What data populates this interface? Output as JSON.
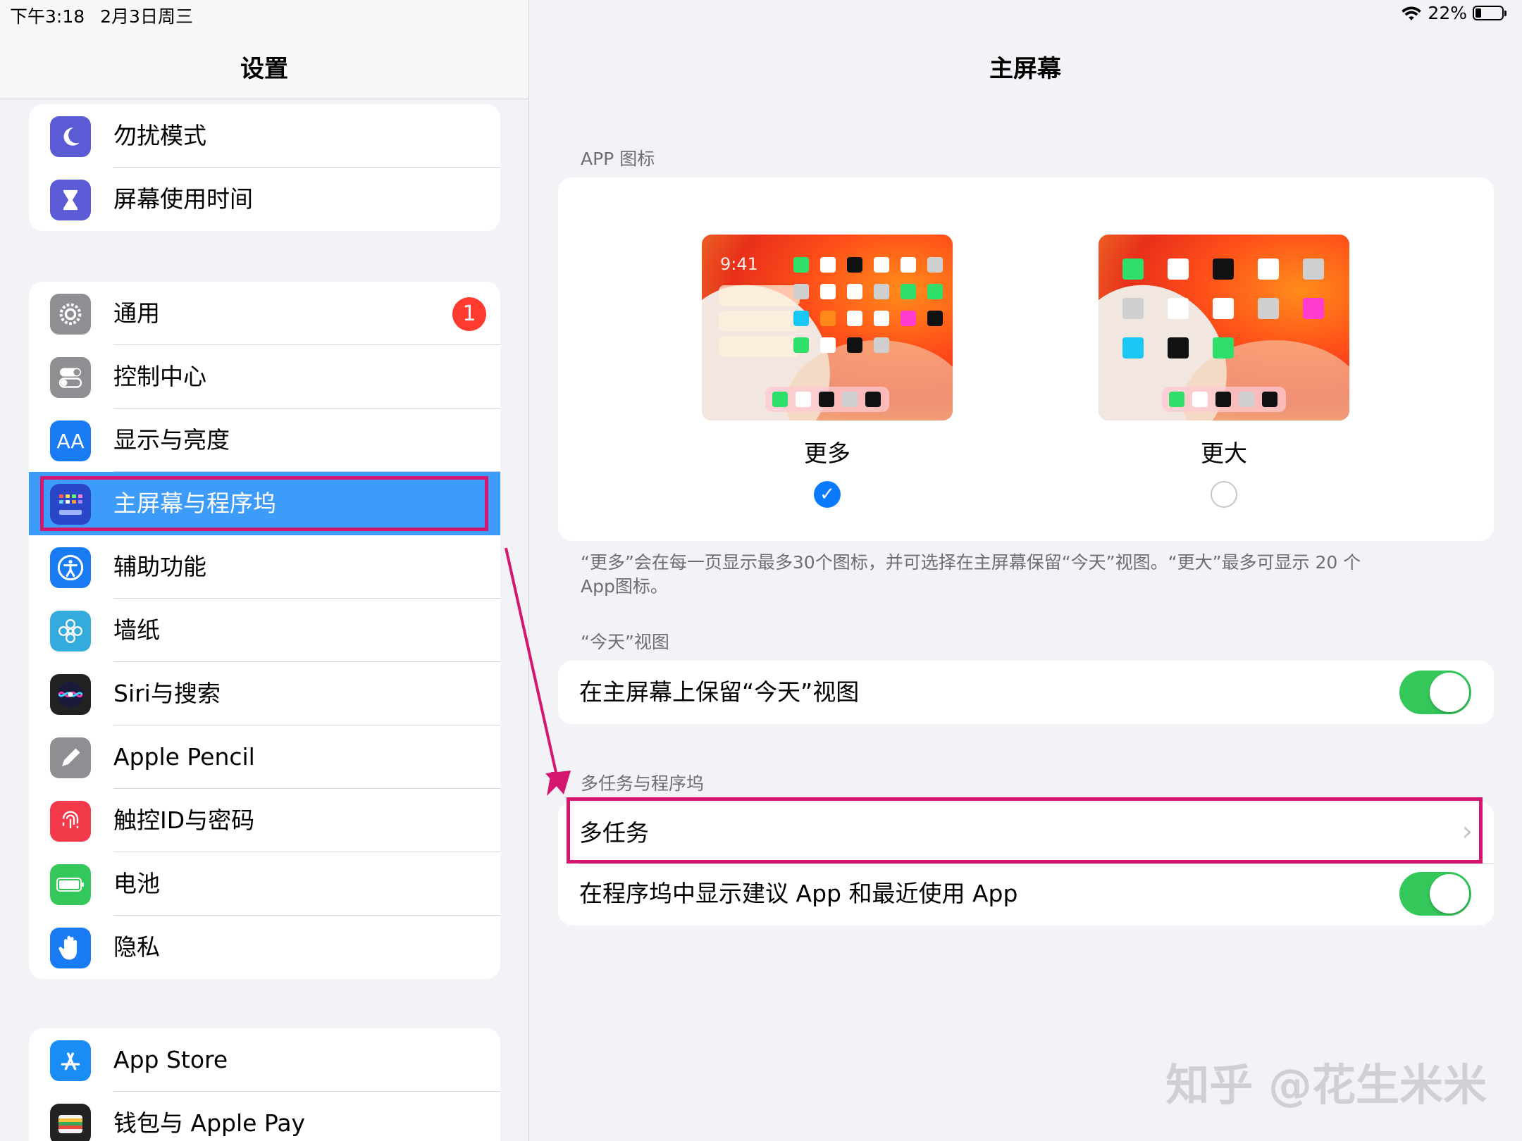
{
  "status_bar": {
    "time": "下午3:18",
    "date": "2月3日周三",
    "battery_percent": "22%",
    "battery_level": 0.22
  },
  "sidebar": {
    "title": "设置",
    "group1": [
      {
        "label": "勿扰模式",
        "icon": "moon-icon",
        "color": "#5b5bd6"
      },
      {
        "label": "屏幕使用时间",
        "icon": "hourglass-icon",
        "color": "#5b5bd6"
      }
    ],
    "group2": [
      {
        "label": "通用",
        "icon": "gear-icon",
        "color": "#8e8e93",
        "badge": "1"
      },
      {
        "label": "控制中心",
        "icon": "toggles-icon",
        "color": "#8e8e93"
      },
      {
        "label": "显示与亮度",
        "icon": "text-size-icon",
        "color": "#1a7cf5",
        "icon_text": "AA"
      },
      {
        "label": "主屏幕与程序坞",
        "icon": "home-grid-icon",
        "color": "#2a46c8",
        "selected": true
      },
      {
        "label": "辅助功能",
        "icon": "accessibility-icon",
        "color": "#1a7cf5"
      },
      {
        "label": "墙纸",
        "icon": "flower-icon",
        "color": "#35aadc"
      },
      {
        "label": "Siri与搜索",
        "icon": "siri-icon",
        "color": "#222"
      },
      {
        "label": "Apple Pencil",
        "icon": "pencil-icon",
        "color": "#8e8e93"
      },
      {
        "label": "触控ID与密码",
        "icon": "fingerprint-icon",
        "color": "#f23a4a"
      },
      {
        "label": "电池",
        "icon": "battery-icon",
        "color": "#34c759"
      },
      {
        "label": "隐私",
        "icon": "hand-icon",
        "color": "#1a7cf5"
      }
    ],
    "group3": [
      {
        "label": "App Store",
        "icon": "app-store-icon",
        "color": "#1a8cf5"
      },
      {
        "label": "钱包与 Apple Pay",
        "icon": "wallet-icon",
        "color": "#222"
      }
    ]
  },
  "main": {
    "title": "主屏幕",
    "app_icons_header": "APP 图标",
    "option_more": {
      "label": "更多",
      "time": "9:41",
      "selected": true
    },
    "option_bigger": {
      "label": "更大",
      "selected": false
    },
    "note_line1": "“更多”会在每一页显示最多30个图标，并可选择在主屏幕保留“今天”视图。“更大”最多可显示 20 个",
    "note_line2": "App图标。",
    "today_header": "“今天”视图",
    "keep_today": {
      "label": "在主屏幕上保留“今天”视图",
      "on": true
    },
    "multitask_header": "多任务与程序坞",
    "multitask": {
      "label": "多任务"
    },
    "dock_suggest": {
      "label": "在程序坞中显示建议 App 和最近使用 App",
      "on": true
    }
  },
  "watermark": "知乎 @花生米米"
}
